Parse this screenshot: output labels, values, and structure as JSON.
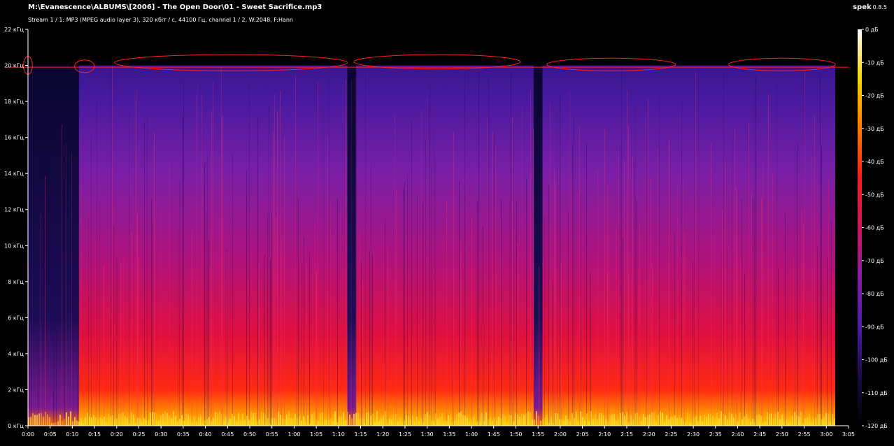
{
  "header": {
    "file_title": "M:\\Evanescence\\ALBUMS\\[2006] - The Open Door\\01 - Sweet Sacrifice.mp3",
    "stream_info": "Stream 1 / 1: MP3 (MPEG audio layer 3), 320 кбіт / с, 44100 Гц, channel 1 / 2, W:2048, F:Hann"
  },
  "app": {
    "name": "spek",
    "version": "0.8.5"
  },
  "chart_data": {
    "type": "heatmap",
    "x_ticks": [
      "0:00",
      "0:05",
      "0:10",
      "0:15",
      "0:20",
      "0:25",
      "0:30",
      "0:35",
      "0:40",
      "0:45",
      "0:50",
      "0:55",
      "1:00",
      "1:05",
      "1:10",
      "1:15",
      "1:20",
      "1:25",
      "1:30",
      "1:35",
      "1:40",
      "1:45",
      "1:50",
      "1:55",
      "2:00",
      "2:05",
      "2:10",
      "2:15",
      "2:20",
      "2:25",
      "2:30",
      "2:35",
      "2:40",
      "2:45",
      "2:50",
      "2:55",
      "3:00",
      "3:05"
    ],
    "x_range_seconds": [
      0,
      185
    ],
    "y_ticks": [
      "0 кГц",
      "2 кГц",
      "4 кГц",
      "6 кГц",
      "8 кГц",
      "10 кГц",
      "12 кГц",
      "14 кГц",
      "16 кГц",
      "18 кГц",
      "20 кГц",
      "22 кГц"
    ],
    "y_range_khz": [
      0,
      22
    ],
    "colorbar_ticks": [
      "0 дБ",
      "-10 дБ",
      "-20 дБ",
      "-30 дБ",
      "-40 дБ",
      "-50 дБ",
      "-60 дБ",
      "-70 дБ",
      "-80 дБ",
      "-90 дБ",
      "-100 дБ",
      "-110 дБ",
      "-120 дБ"
    ],
    "colorbar_range_db": [
      -120,
      0
    ],
    "audio_end_seconds": 182,
    "cutoff_khz": 20,
    "quiet_segments_seconds": [
      [
        0,
        11.5
      ],
      [
        72,
        74
      ],
      [
        114,
        116
      ]
    ],
    "highlight_line_khz": 19.9,
    "annotation_ellipses": [
      {
        "x": [
          -1,
          1
        ],
        "khz": [
          19.5,
          20.5
        ]
      },
      {
        "x": [
          10.5,
          15
        ],
        "khz": [
          19.6,
          20.3
        ]
      },
      {
        "x": [
          19.5,
          72
        ],
        "khz": [
          19.7,
          20.6
        ]
      },
      {
        "x": [
          73.5,
          111
        ],
        "khz": [
          19.8,
          20.6
        ]
      },
      {
        "x": [
          117,
          146
        ],
        "khz": [
          19.7,
          20.4
        ]
      },
      {
        "x": [
          158,
          182
        ],
        "khz": [
          19.7,
          20.4
        ]
      }
    ],
    "colors": {
      "annotation": "#ff2020",
      "colormap": [
        "#000000",
        "#1a0b4a",
        "#4e1ba8",
        "#8a1aa8",
        "#d0145a",
        "#ff1a1a",
        "#ff7a00",
        "#ffd400",
        "#ffffff"
      ]
    }
  }
}
